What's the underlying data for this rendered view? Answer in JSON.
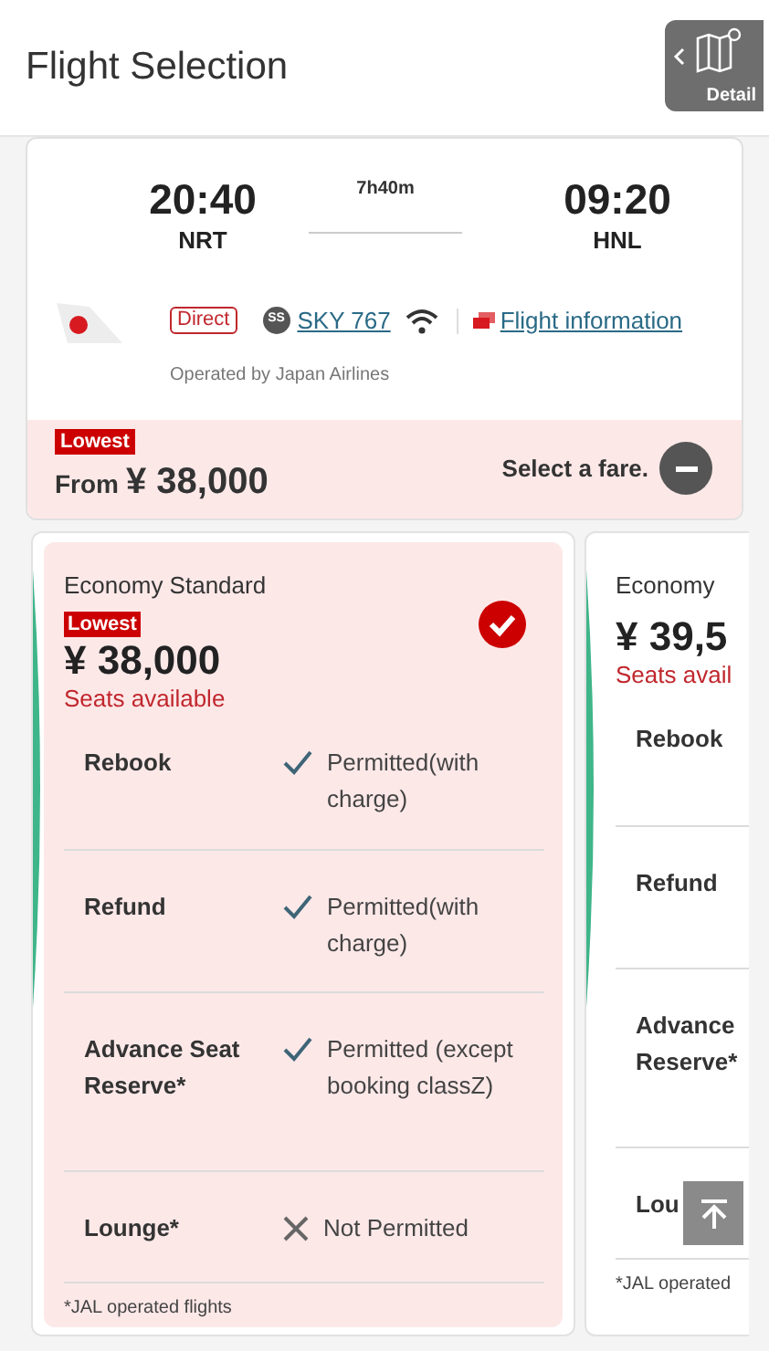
{
  "header": {
    "title": "Flight Selection",
    "detail_button": "Detail"
  },
  "flight": {
    "departure": {
      "time": "20:40",
      "airport": "NRT"
    },
    "duration": "7h40m",
    "arrival": {
      "time": "09:20",
      "airport": "HNL"
    },
    "direct_badge": "Direct",
    "aircraft_code": "SS",
    "aircraft_link": "SKY 767",
    "wifi": true,
    "info_link": "Flight information",
    "operator": "Operated by Japan Airlines"
  },
  "price_summary": {
    "badge": "Lowest",
    "from_label": "From",
    "price": "¥ 38,000",
    "prompt": "Select a fare.",
    "expanded": true
  },
  "fares": [
    {
      "name": "Economy Standard",
      "badge": "Lowest",
      "price": "¥ 38,000",
      "availability": "Seats available",
      "selected": true,
      "rows": [
        {
          "label": "Rebook",
          "kind": "permitted",
          "value": "Permitted(with charge)"
        },
        {
          "label": "Refund",
          "kind": "permitted",
          "value": "Permitted(with charge)"
        },
        {
          "label": "Advance Seat Reserve*",
          "kind": "permitted",
          "value": "Permitted (except booking classZ)"
        },
        {
          "label": "Lounge*",
          "kind": "not_permitted",
          "value": "Not Permitted"
        }
      ],
      "footnote": "*JAL operated flights"
    },
    {
      "name": "Economy",
      "price": "¥ 39,5",
      "availability": "Seats avail",
      "selected": false,
      "rows": [
        {
          "label": "Rebook"
        },
        {
          "label": "Refund"
        },
        {
          "label": "Advance Reserve*"
        },
        {
          "label": "Lou"
        }
      ],
      "footnote": "*JAL operated"
    }
  ]
}
